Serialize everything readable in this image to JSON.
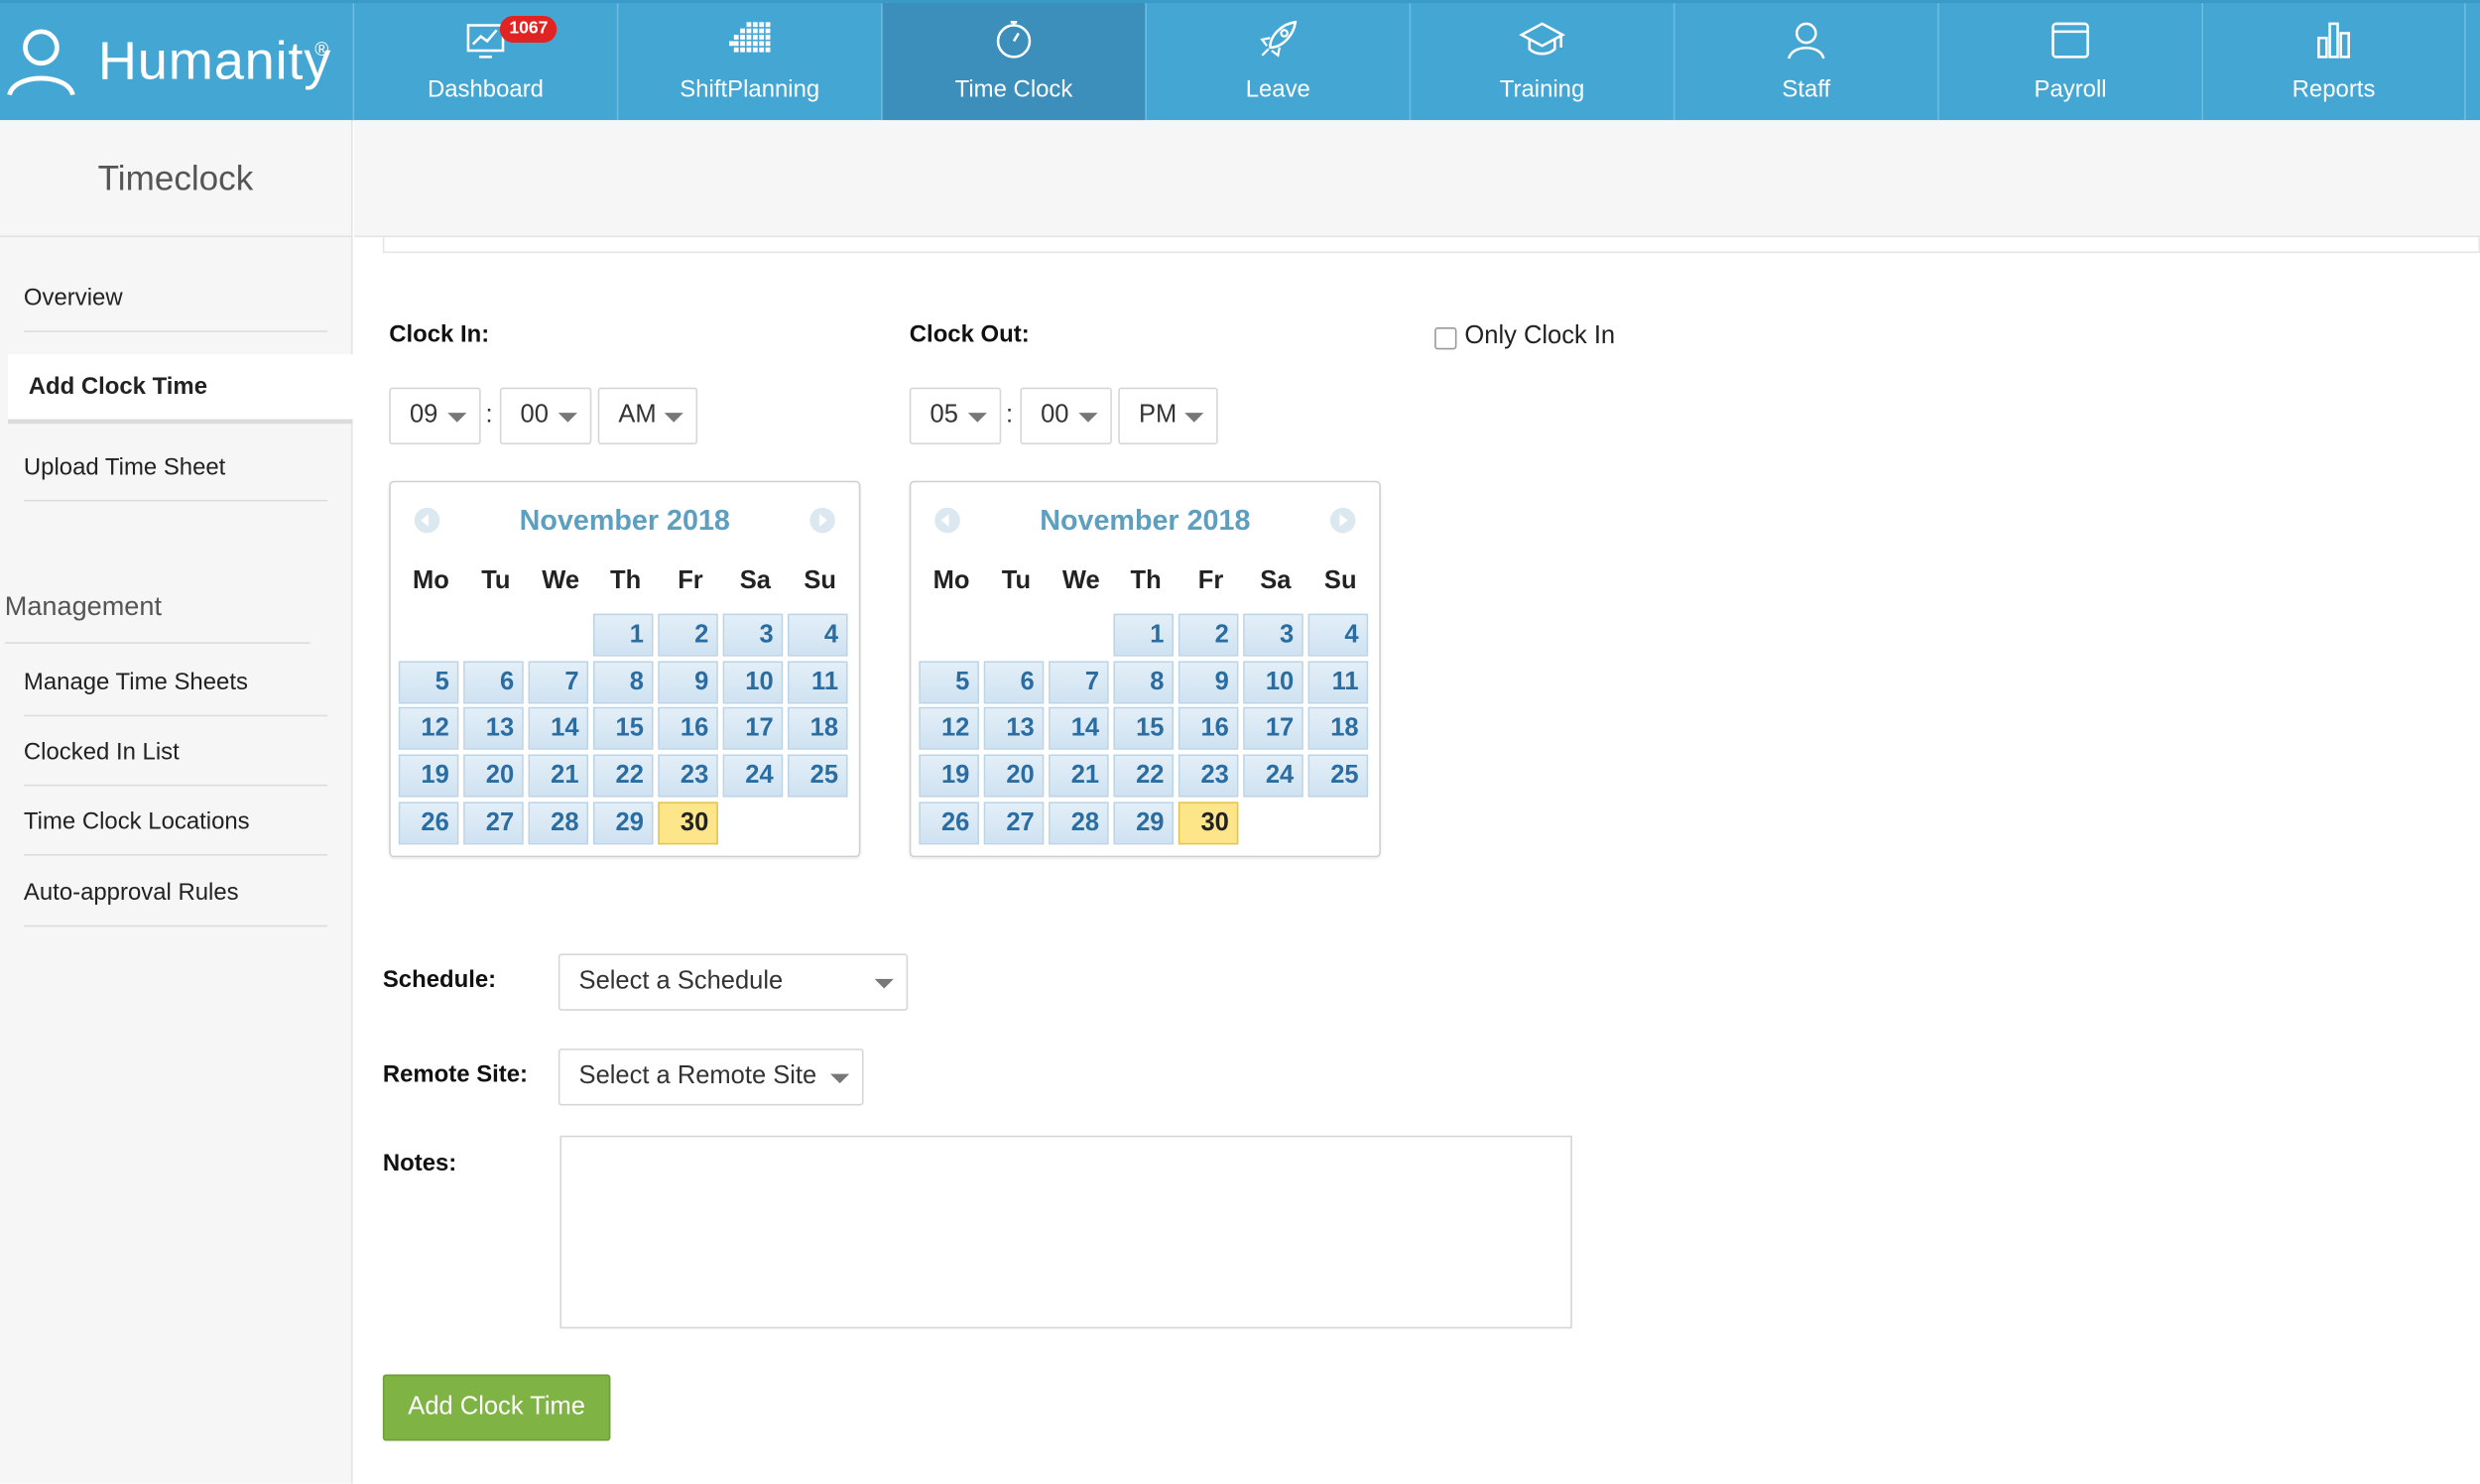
{
  "brand": {
    "name": "Humanity",
    "reg": "®"
  },
  "nav": [
    {
      "label": "Dashboard",
      "icon": "dashboard-icon",
      "badge": "1067"
    },
    {
      "label": "ShiftPlanning",
      "icon": "shiftplanning-icon"
    },
    {
      "label": "Time Clock",
      "icon": "stopwatch-icon",
      "active": true
    },
    {
      "label": "Leave",
      "icon": "rocket-icon"
    },
    {
      "label": "Training",
      "icon": "graduation-cap-icon"
    },
    {
      "label": "Staff",
      "icon": "user-icon"
    },
    {
      "label": "Payroll",
      "icon": "wallet-icon"
    },
    {
      "label": "Reports",
      "icon": "bar-chart-icon"
    }
  ],
  "sidebar": {
    "title": "Timeclock",
    "items": [
      {
        "label": "Overview"
      },
      {
        "label": "Add Clock Time",
        "active": true
      },
      {
        "label": "Upload Time Sheet"
      }
    ],
    "section": "Management",
    "management_items": [
      {
        "label": "Manage Time Sheets"
      },
      {
        "label": "Clocked In List"
      },
      {
        "label": "Time Clock Locations"
      },
      {
        "label": "Auto-approval Rules"
      }
    ]
  },
  "form": {
    "clock_in": {
      "label": "Clock In:",
      "hour": "09",
      "minute": "00",
      "ampm": "AM"
    },
    "clock_out": {
      "label": "Clock Out:",
      "hour": "05",
      "minute": "00",
      "ampm": "PM"
    },
    "time_separator": ":",
    "only_clock_in": {
      "label": "Only Clock In",
      "checked": false
    },
    "schedule": {
      "label": "Schedule:",
      "value": "Select a Schedule"
    },
    "remote_site": {
      "label": "Remote Site:",
      "value": "Select a Remote Site"
    },
    "notes": {
      "label": "Notes:",
      "value": ""
    },
    "submit_label": "Add Clock Time"
  },
  "calendar": {
    "month_label": "November 2018",
    "weekdays": [
      "Mo",
      "Tu",
      "We",
      "Th",
      "Fr",
      "Sa",
      "Su"
    ],
    "leading_blanks": 3,
    "days_in_month": 30,
    "selected_day": 30
  },
  "colors": {
    "nav_bg": "#44a6d3",
    "nav_active": "#3c8fbb",
    "badge": "#e02424",
    "today": "#fde58a",
    "button": "#7fb344"
  }
}
